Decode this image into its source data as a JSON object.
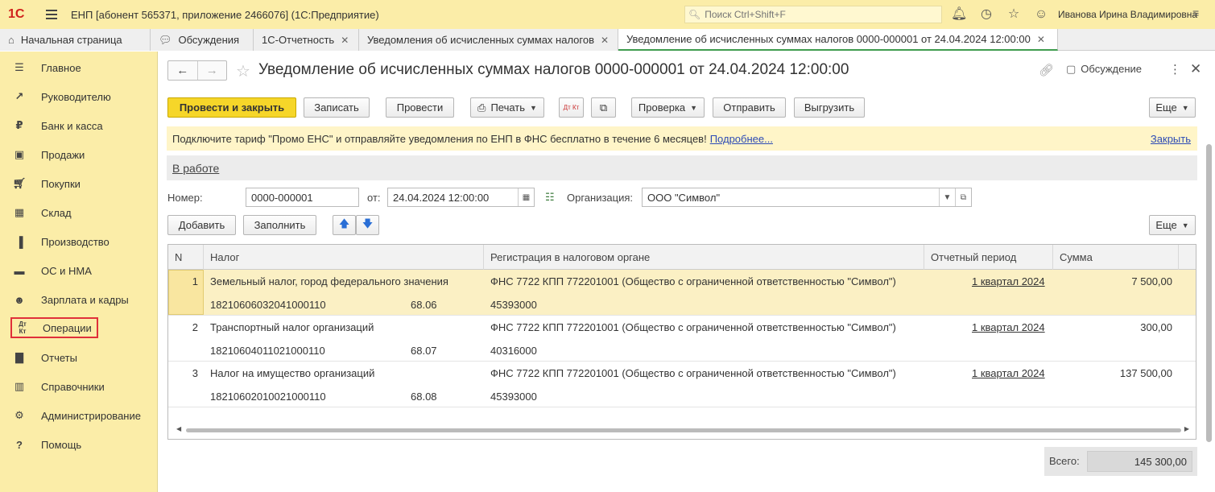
{
  "app": {
    "logo": "1С",
    "title": "ЕНП [абонент 565371, приложение 2466076]  (1С:Предприятие)",
    "search_placeholder": "Поиск Ctrl+Shift+F",
    "user": "Иванова Ирина Владимировна"
  },
  "tabs": [
    {
      "label": "Начальная страница"
    },
    {
      "label": "Обсуждения"
    },
    {
      "label": "1С-Отчетность"
    },
    {
      "label": "Уведомления об исчисленных суммах налогов"
    },
    {
      "label": "Уведомление об исчисленных суммах налогов 0000-000001 от 24.04.2024 12:00:00"
    }
  ],
  "sidebar": {
    "items": [
      {
        "label": "Главное"
      },
      {
        "label": "Руководителю"
      },
      {
        "label": "Банк и касса"
      },
      {
        "label": "Продажи"
      },
      {
        "label": "Покупки"
      },
      {
        "label": "Склад"
      },
      {
        "label": "Производство"
      },
      {
        "label": "ОС и НМА"
      },
      {
        "label": "Зарплата и кадры"
      },
      {
        "label": "Операции"
      },
      {
        "label": "Отчеты"
      },
      {
        "label": "Справочники"
      },
      {
        "label": "Администрирование"
      },
      {
        "label": "Помощь"
      }
    ]
  },
  "document": {
    "title": "Уведомление об исчисленных суммах налогов 0000-000001 от 24.04.2024 12:00:00",
    "discuss_label": "Обсуждение"
  },
  "toolbar": {
    "post_close": "Провести и закрыть",
    "save": "Записать",
    "post": "Провести",
    "print": "Печать",
    "dt_kt": "Дт Кт",
    "check": "Проверка",
    "send": "Отправить",
    "upload": "Выгрузить",
    "more": "Еще"
  },
  "banner": {
    "text": "Подключите тариф \"Промо ЕНС\" и отправляйте уведомления по ЕНП в ФНС бесплатно в течение 6 месяцев!",
    "more_link": "Подробнее...",
    "close_link": "Закрыть"
  },
  "status": "В работе",
  "form": {
    "number_label": "Номер:",
    "number_value": "0000-000001",
    "from_label": "от:",
    "date_value": "24.04.2024 12:00:00",
    "org_label": "Организация:",
    "org_value": "ООО \"Символ\""
  },
  "table_toolbar": {
    "add": "Добавить",
    "fill": "Заполнить",
    "more": "Еще"
  },
  "table": {
    "columns": [
      "N",
      "Налог",
      "Регистрация в налоговом органе",
      "Отчетный период",
      "Сумма"
    ],
    "rows": [
      {
        "n": "1",
        "tax": "Земельный налог, город федерального значения",
        "kbk": "18210606032041000110",
        "code": "68.06",
        "reg": "ФНС 7722 КПП 772201001 (Общество с ограниченной ответственностью \"Символ\")",
        "oktmo": "45393000",
        "period": "1 квартал 2024",
        "sum": "7 500,00"
      },
      {
        "n": "2",
        "tax": "Транспортный налог организаций",
        "kbk": "18210604011021000110",
        "code": "68.07",
        "reg": "ФНС 7722 КПП 772201001 (Общество с ограниченной ответственностью \"Символ\")",
        "oktmo": "40316000",
        "period": "1 квартал 2024",
        "sum": "300,00"
      },
      {
        "n": "3",
        "tax": "Налог на имущество организаций",
        "kbk": "18210602010021000110",
        "code": "68.08",
        "reg": "ФНС 7722 КПП 772201001 (Общество с ограниченной ответственностью \"Символ\")",
        "oktmo": "45393000",
        "period": "1 квартал 2024",
        "sum": "137 500,00"
      }
    ]
  },
  "total": {
    "label": "Всего:",
    "value": "145 300,00"
  },
  "colors": {
    "accent_yellow": "#f6d629",
    "panel_yellow": "#fbeda8",
    "selected_row": "#fbf0c4",
    "highlight_red": "#e0303a"
  }
}
